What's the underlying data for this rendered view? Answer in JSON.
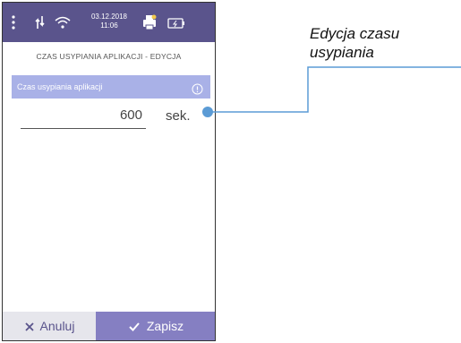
{
  "status_bar": {
    "date": "03.12.2018",
    "time": "11:06",
    "icons": [
      "menu-dots-icon",
      "signal-icon",
      "wifi-icon",
      "printer-icon",
      "battery-icon"
    ]
  },
  "screen": {
    "title": "CZAS USYPIANIA APLIKACJI - EDYCJA",
    "field_label": "Czas usypiania aplikacji",
    "value": "600",
    "unit": "sek."
  },
  "buttons": {
    "cancel": "Anuluj",
    "save": "Zapisz"
  },
  "callout": {
    "line1": "Edycja czasu",
    "line2": "usypiania"
  },
  "colors": {
    "status_bar": "#5a548c",
    "field_header": "#a9b1e7",
    "save_button": "#857fc2",
    "cancel_button": "#e6e6ec",
    "callout": "#5b9bd5"
  }
}
